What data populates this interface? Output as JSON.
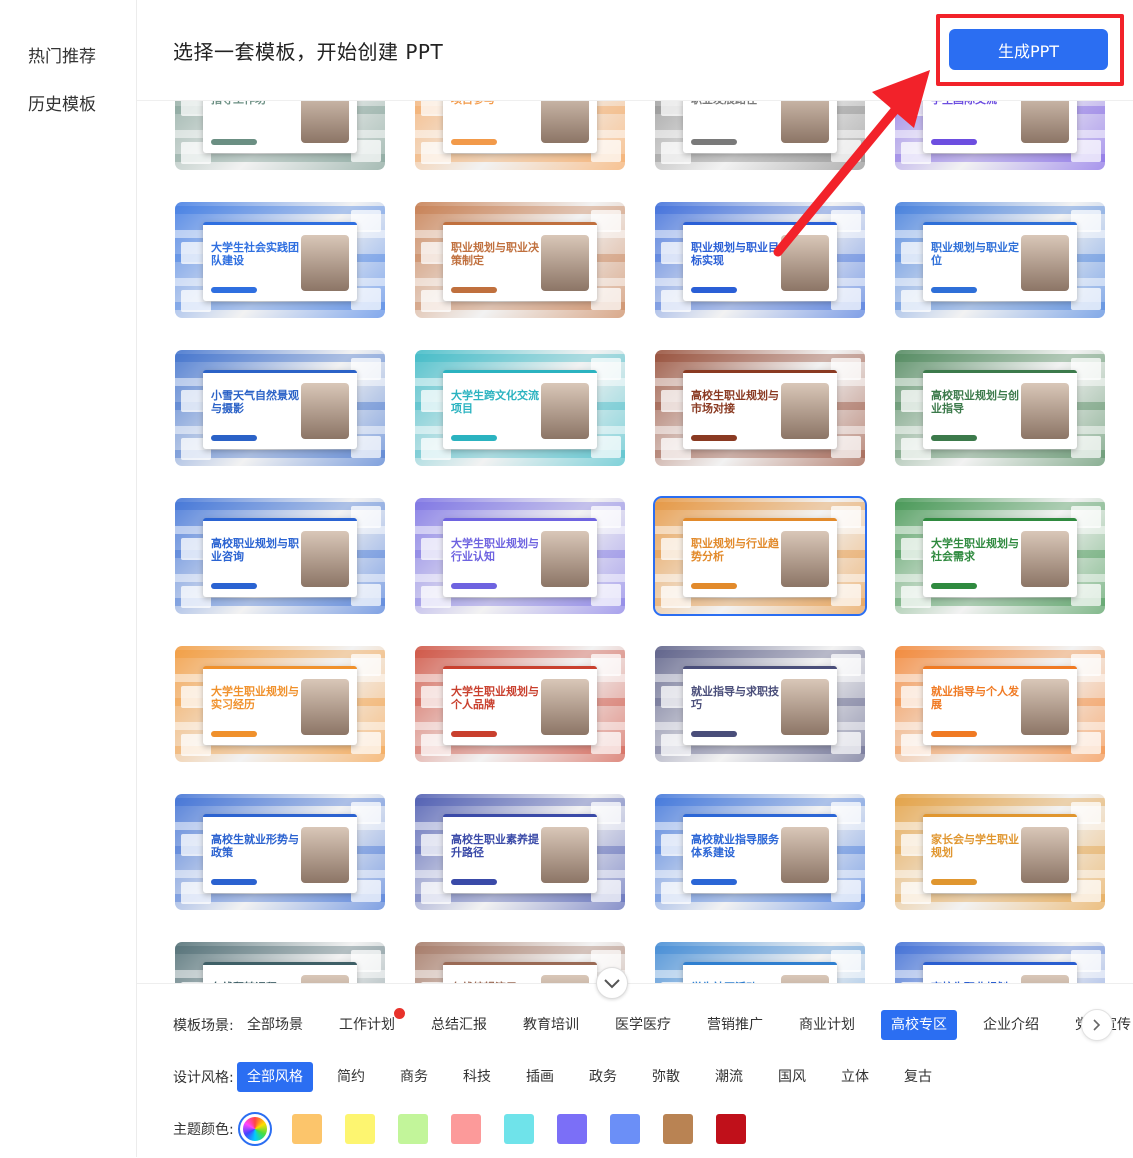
{
  "sidebar": {
    "items": [
      {
        "label": "热门推荐"
      },
      {
        "label": "历史模板"
      }
    ]
  },
  "header": {
    "title": "选择一套模板，开始创建 PPT",
    "generate_label": "生成PPT"
  },
  "cards": [
    {
      "title": "指导工作坊",
      "theme": "#6b8f83"
    },
    {
      "title": "项目参与",
      "theme": "#f29a4a"
    },
    {
      "title": "职业发展路径",
      "theme": "#7a7a7a"
    },
    {
      "title": "学生国际交流",
      "theme": "#6d4ee0"
    },
    {
      "title": "大学生社会实践团队建设",
      "theme": "#2f6fe0"
    },
    {
      "title": "职业规划与职业决策制定",
      "theme": "#c0703e"
    },
    {
      "title": "职业规划与职业目标实现",
      "theme": "#2a5fd6"
    },
    {
      "title": "职业规划与职业定位",
      "theme": "#2e6fd8"
    },
    {
      "title": "小雪天气自然景观与摄影",
      "theme": "#2b62c7"
    },
    {
      "title": "大学生跨文化交流项目",
      "theme": "#2bb3c0"
    },
    {
      "title": "高校生职业规划与市场对接",
      "theme": "#8a3a22"
    },
    {
      "title": "高校职业规划与创业指导",
      "theme": "#3c7a4b"
    },
    {
      "title": "高校职业规划与职业咨询",
      "theme": "#2a63d2"
    },
    {
      "title": "大学生职业规划与行业认知",
      "theme": "#6e63e0"
    },
    {
      "title": "职业规划与行业趋势分析",
      "theme": "#e28a2b"
    },
    {
      "title": "大学生职业规划与社会需求",
      "theme": "#2f8a3f"
    },
    {
      "title": "大学生职业规划与实习经历",
      "theme": "#f0912c"
    },
    {
      "title": "大学生职业规划与个人品牌",
      "theme": "#c9402e"
    },
    {
      "title": "就业指导与求职技巧",
      "theme": "#4a4e7a"
    },
    {
      "title": "就业指导与个人发展",
      "theme": "#f07a23"
    },
    {
      "title": "高校生就业形势与政策",
      "theme": "#2b62d0"
    },
    {
      "title": "高校生职业素养提升路径",
      "theme": "#3a4aa8"
    },
    {
      "title": "高校就业指导服务体系建设",
      "theme": "#2b66d6"
    },
    {
      "title": "家长会与学生职业规划",
      "theme": "#e0962f"
    },
    {
      "title": "在线翻转课程",
      "theme": "#3e5f66"
    },
    {
      "title": "在线编辑演示",
      "theme": "#9a6a55"
    },
    {
      "title": "学生社区活动",
      "theme": "#2f7fd0"
    },
    {
      "title": "高校生职业规划",
      "theme": "#2a5ed0"
    }
  ],
  "filters": {
    "scene": {
      "label": "模板场景:",
      "items": [
        "全部场景",
        "工作计划",
        "总结汇报",
        "教育培训",
        "医学医疗",
        "营销推广",
        "商业计划",
        "高校专区",
        "企业介绍",
        "党政宣传"
      ]
    },
    "style": {
      "label": "设计风格:",
      "items": [
        "全部风格",
        "简约",
        "商务",
        "科技",
        "插画",
        "政务",
        "弥散",
        "潮流",
        "国风",
        "立体",
        "复古"
      ]
    },
    "color": {
      "label": "主题颜色:",
      "swatches": [
        "rainbow",
        "#fcc56b",
        "#fdf570",
        "#c2f59a",
        "#fc9a9a",
        "#6fe3ea",
        "#7b6ff7",
        "#6b8ff7",
        "#b98353",
        "#c0101a"
      ]
    }
  }
}
